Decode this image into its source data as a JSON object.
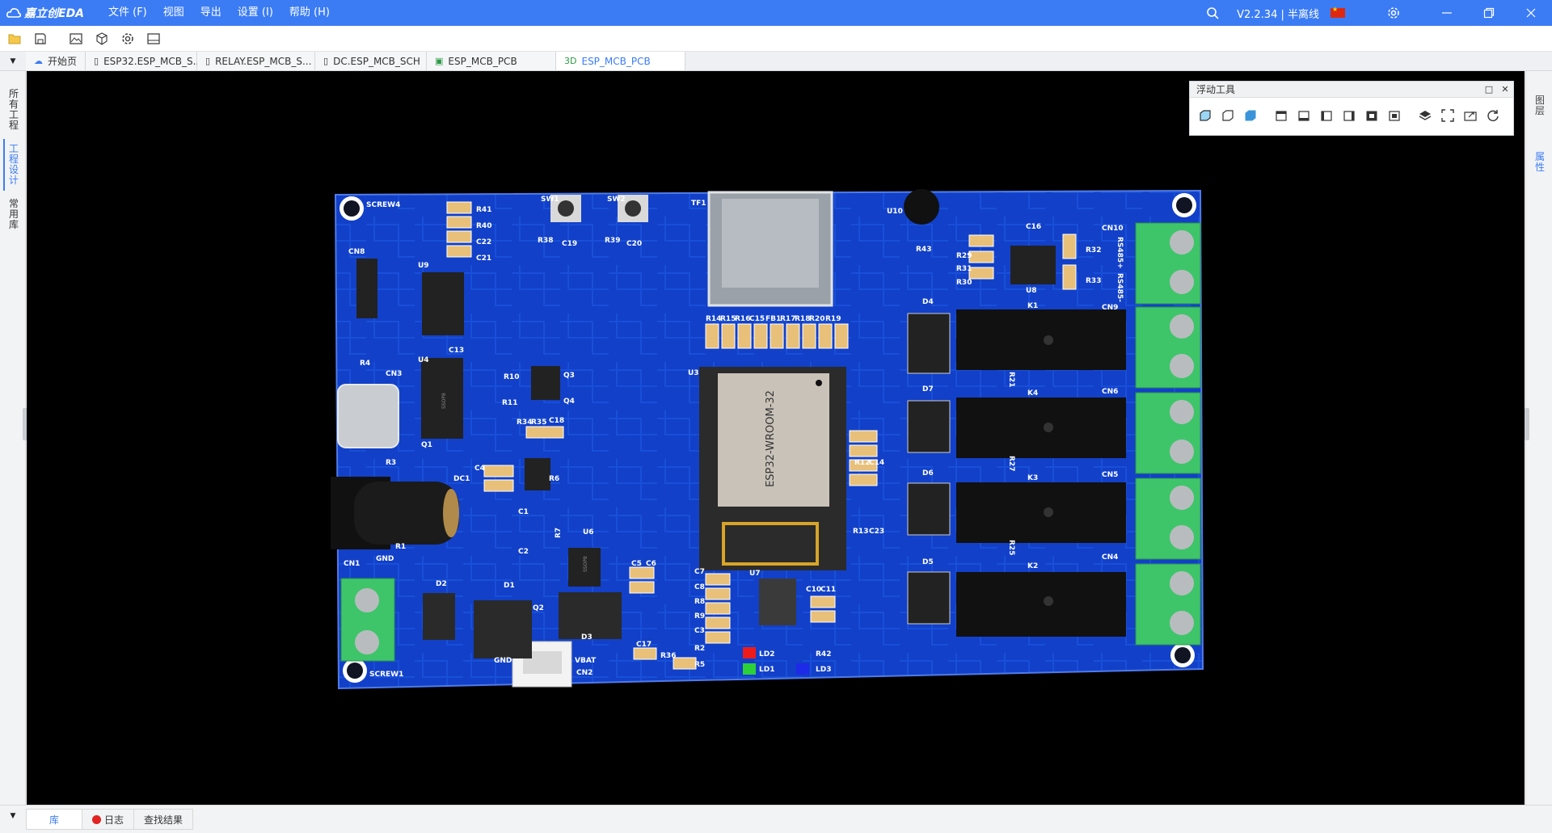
{
  "app": {
    "logo_text": "嘉立创EDA",
    "version_text": "V2.2.34 | 半离线"
  },
  "menu": [
    {
      "label": "文件 (F)"
    },
    {
      "label": "视图"
    },
    {
      "label": "导出"
    },
    {
      "label": "设置 (I)"
    },
    {
      "label": "帮助 (H)"
    }
  ],
  "toolbar_icons": [
    "folder-icon",
    "save-icon",
    "image-icon",
    "cube-export-icon",
    "settings-icon",
    "panel-icon"
  ],
  "tabs": [
    {
      "label": "开始页",
      "icon": "cloud-icon"
    },
    {
      "label": "ESP32.ESP_MCB_S...",
      "icon": "schematic-icon"
    },
    {
      "label": "RELAY.ESP_MCB_S...",
      "icon": "schematic-icon"
    },
    {
      "label": "DC.ESP_MCB_SCH",
      "icon": "schematic-icon"
    },
    {
      "label": "ESP_MCB_PCB",
      "icon": "pcb-icon"
    },
    {
      "label": "ESP_MCB_PCB",
      "prefix": "3D",
      "active": true
    }
  ],
  "left_panel": [
    {
      "label": "所有工程"
    },
    {
      "label": "工程设计",
      "active": true
    },
    {
      "label": "常用库"
    }
  ],
  "right_panel": [
    {
      "label": "图层"
    },
    {
      "label": "属性",
      "active": true
    }
  ],
  "float_panel": {
    "title": "浮动工具"
  },
  "bottom_tabs": [
    {
      "label": "库",
      "active": true
    },
    {
      "label": "日志",
      "indicator": "red-dot"
    },
    {
      "label": "查找结果"
    }
  ],
  "pcb": {
    "module_label": "ESP32-WROOM-32",
    "designators": {
      "screw4": "SCREW4",
      "screw1": "SCREW1",
      "sw1": "SW1",
      "sw2": "SW2",
      "tf1": "TF1",
      "u10": "U10",
      "r41": "R41",
      "r40": "R40",
      "c22": "C22",
      "c21": "C21",
      "r38": "R38",
      "c19": "C19",
      "r39": "R39",
      "c20": "C20",
      "cn8": "CN8",
      "u9": "U9",
      "r43": "R43",
      "c16": "C16",
      "r29": "R29",
      "r31": "R31",
      "r30": "R30",
      "u8": "U8",
      "r32": "R32",
      "r33": "R33",
      "cn10": "CN10",
      "rs485p": "RS485+",
      "rs485m": "RS485-",
      "cn9": "CN9",
      "d4": "D4",
      "k1": "K1",
      "r14": "R14",
      "r15": "R15",
      "r16": "R16",
      "c15": "C15",
      "fb1": "FB1",
      "r17": "R17",
      "r18": "R18",
      "r20": "R20",
      "r19": "R19",
      "r4": "R4",
      "cn3": "CN3",
      "u4": "U4",
      "c13": "C13",
      "r10": "R10",
      "q3": "Q3",
      "r11": "R11",
      "q4": "Q4",
      "u3": "U3",
      "r21": "R21",
      "d7": "D7",
      "k4": "K4",
      "cn6": "CN6",
      "r34": "R34",
      "r35": "R35",
      "c18": "C18",
      "q1": "Q1",
      "r3": "R3",
      "r12": "R12",
      "c14": "C14",
      "r27": "R27",
      "d6": "D6",
      "k3": "K3",
      "cn5": "CN5",
      "dc1": "DC1",
      "c4": "C4",
      "r6": "R6",
      "c1": "C1",
      "c2": "C2",
      "r7": "R7",
      "u6": "U6",
      "r13": "R13",
      "c23": "C23",
      "r25": "R25",
      "d5": "D5",
      "k2": "K2",
      "cn4": "CN4",
      "r1": "R1",
      "gnd": "GND",
      "cn1": "CN1",
      "d2": "D2",
      "d1": "D1",
      "q2": "Q2",
      "d3": "D3",
      "c5": "C5",
      "c6": "C6",
      "c7": "C7",
      "c8": "C8",
      "r8": "R8",
      "r9": "R9",
      "c3": "C3",
      "r2": "R2",
      "r5": "R5",
      "u7": "U7",
      "c10": "C10",
      "c11": "C11",
      "ld2": "LD2",
      "r42": "R42",
      "ld1": "LD1",
      "ld3": "LD3",
      "vbat": "VBAT",
      "cn2": "CN2",
      "c17": "C17",
      "r36": "R36",
      "gnd2": "GND"
    },
    "chip_marks": {
      "u6": "SSOP8",
      "u4": "SSOP8"
    }
  },
  "colors": {
    "brand": "#3b7cf4",
    "board": "#1240c8",
    "terminal": "#3ec56a",
    "canvas": "#000000"
  }
}
